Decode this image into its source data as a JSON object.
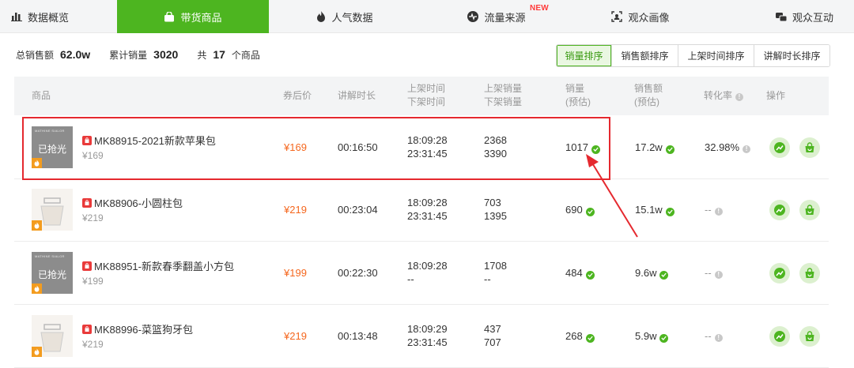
{
  "tabs": [
    {
      "label": "数据概览",
      "icon": "bar-chart-icon"
    },
    {
      "label": "带货商品",
      "icon": "shopping-bag-icon"
    },
    {
      "label": "人气数据",
      "icon": "fire-icon"
    },
    {
      "label": "流量来源",
      "icon": "pulse-icon",
      "badge": "NEW"
    },
    {
      "label": "观众画像",
      "icon": "face-scan-icon"
    },
    {
      "label": "观众互动",
      "icon": "chat-icon"
    }
  ],
  "summary": {
    "total_sales_label": "总销售额",
    "total_sales_value": "62.0w",
    "cumulative_label": "累计销量",
    "cumulative_value": "3020",
    "count_prefix": "共",
    "count_value": "17",
    "count_suffix": "个商品"
  },
  "sort_buttons": [
    "销量排序",
    "销售额排序",
    "上架时间排序",
    "讲解时长排序"
  ],
  "columns": {
    "product": "商品",
    "price": "券后价",
    "duration": "讲解时长",
    "shelf_time_1": "上架时间",
    "shelf_time_2": "下架时间",
    "shelf_sales_1": "上架销量",
    "shelf_sales_2": "下架销量",
    "sales_1": "销量",
    "sales_2": "(预估)",
    "revenue_1": "销售额",
    "revenue_2": "(预估)",
    "conversion": "转化率",
    "action": "操作"
  },
  "rows": [
    {
      "name": "MK88915-2021新款苹果包",
      "list_price": "¥169",
      "sold_out": "已抢光",
      "price": "¥169",
      "duration": "00:16:50",
      "on_time": "18:09:28",
      "off_time": "23:31:45",
      "on_sales": "2368",
      "off_sales": "3390",
      "sales": "1017",
      "revenue": "17.2w",
      "conversion": "32.98%"
    },
    {
      "name": "MK88906-小圆柱包",
      "list_price": "¥219",
      "sold_out": "",
      "price": "¥219",
      "duration": "00:23:04",
      "on_time": "18:09:28",
      "off_time": "23:31:45",
      "on_sales": "703",
      "off_sales": "1395",
      "sales": "690",
      "revenue": "15.1w",
      "conversion": "--"
    },
    {
      "name": "MK88951-新款春季翻盖小方包",
      "list_price": "¥199",
      "sold_out": "已抢光",
      "price": "¥199",
      "duration": "00:22:30",
      "on_time": "18:09:28",
      "off_time": "--",
      "on_sales": "1708",
      "off_sales": "--",
      "sales": "484",
      "revenue": "9.6w",
      "conversion": "--"
    },
    {
      "name": "MK88996-菜篮狗牙包",
      "list_price": "¥219",
      "sold_out": "",
      "price": "¥219",
      "duration": "00:13:48",
      "on_time": "18:09:29",
      "off_time": "23:31:45",
      "on_sales": "437",
      "off_sales": "707",
      "sales": "268",
      "revenue": "5.9w",
      "conversion": "--"
    }
  ],
  "thumb_brand_text": "MATHINE SIALOR",
  "colors": {
    "accent": "#4db520",
    "price": "#f5671e",
    "highlight": "#e5292f",
    "new_badge": "#ff3b3b"
  }
}
